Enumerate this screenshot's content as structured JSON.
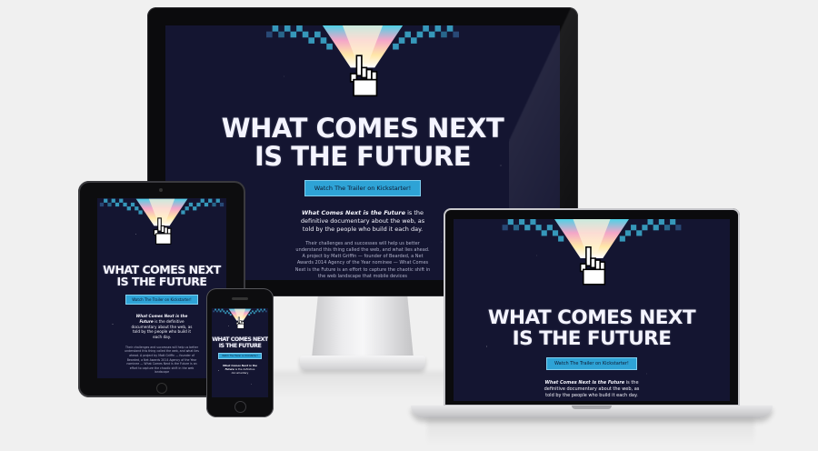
{
  "hero": {
    "headline_line1": "WHAT COMES NEXT",
    "headline_line2": "IS THE FUTURE",
    "cta_label": "Watch The Trailer on Kickstarter!",
    "tagline_title": "What Comes Next is the Future",
    "tagline_rest_desktop": " is the definitive documentary about the web, as told by the people who build it each day.",
    "tagline_rest_tablet": " is the definitive documentary about the web, as told by the people who build it each day.",
    "tagline_rest_laptop": " is the definitive documentary about the web, as told by the people who build it each day.",
    "tagline_rest_phone": " is the definitive documentary",
    "body_desktop": "Their challenges and successes will help us better understand this thing called the web, and what lies ahead. A project by Matt Griffin — founder of Bearded, a Net Awards 2014 Agency of the Year nominee — What Comes Next is the Future is an effort to capture the chaotic shift in the web landscape that mobile devices",
    "body_tablet": "Their challenges and successes will help us better understand this thing called the web, and what lies ahead. A project by Matt Griffin — founder of Bearded, a Net Awards 2014 Agency of the Year nominee — What Comes Next is the Future is an effort to capture the chaotic shift in the web landscape"
  },
  "colors": {
    "background": "#141531",
    "button": "#2ea3d6",
    "headline": "#f4f4ff",
    "page": "#f0f0f0"
  },
  "icons": [
    "pixel-hand-cursor-icon"
  ]
}
